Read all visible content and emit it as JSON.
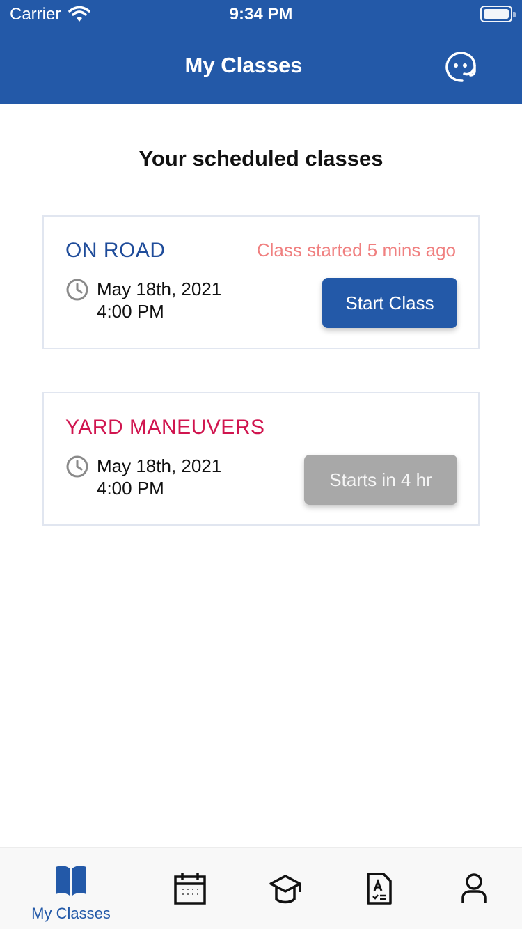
{
  "status_bar": {
    "carrier": "Carrier",
    "time": "9:34 PM"
  },
  "header": {
    "title": "My Classes",
    "support_icon": "support-chat-icon",
    "background_color": "#2359a8"
  },
  "main": {
    "section_title": "Your scheduled classes",
    "classes": [
      {
        "name": "ON ROAD",
        "status": "Class started 5 mins ago",
        "date": "May 18th, 2021",
        "time": "4:00 PM",
        "button_label": "Start Class",
        "name_color": "#1f4c9a",
        "button_enabled": true
      },
      {
        "name": "YARD MANEUVERS",
        "status": "",
        "date": "May 18th, 2021",
        "time": "4:00 PM",
        "button_label": "Starts in 4 hr",
        "name_color": "#d0154f",
        "button_enabled": false
      }
    ]
  },
  "tabbar": {
    "active_index": 0,
    "items": [
      {
        "icon": "book-open-icon",
        "label": "My Classes"
      },
      {
        "icon": "calendar-icon",
        "label": ""
      },
      {
        "icon": "graduation-cap-icon",
        "label": ""
      },
      {
        "icon": "grade-report-icon",
        "label": ""
      },
      {
        "icon": "user-profile-icon",
        "label": ""
      }
    ],
    "active_color": "#2359a8"
  }
}
